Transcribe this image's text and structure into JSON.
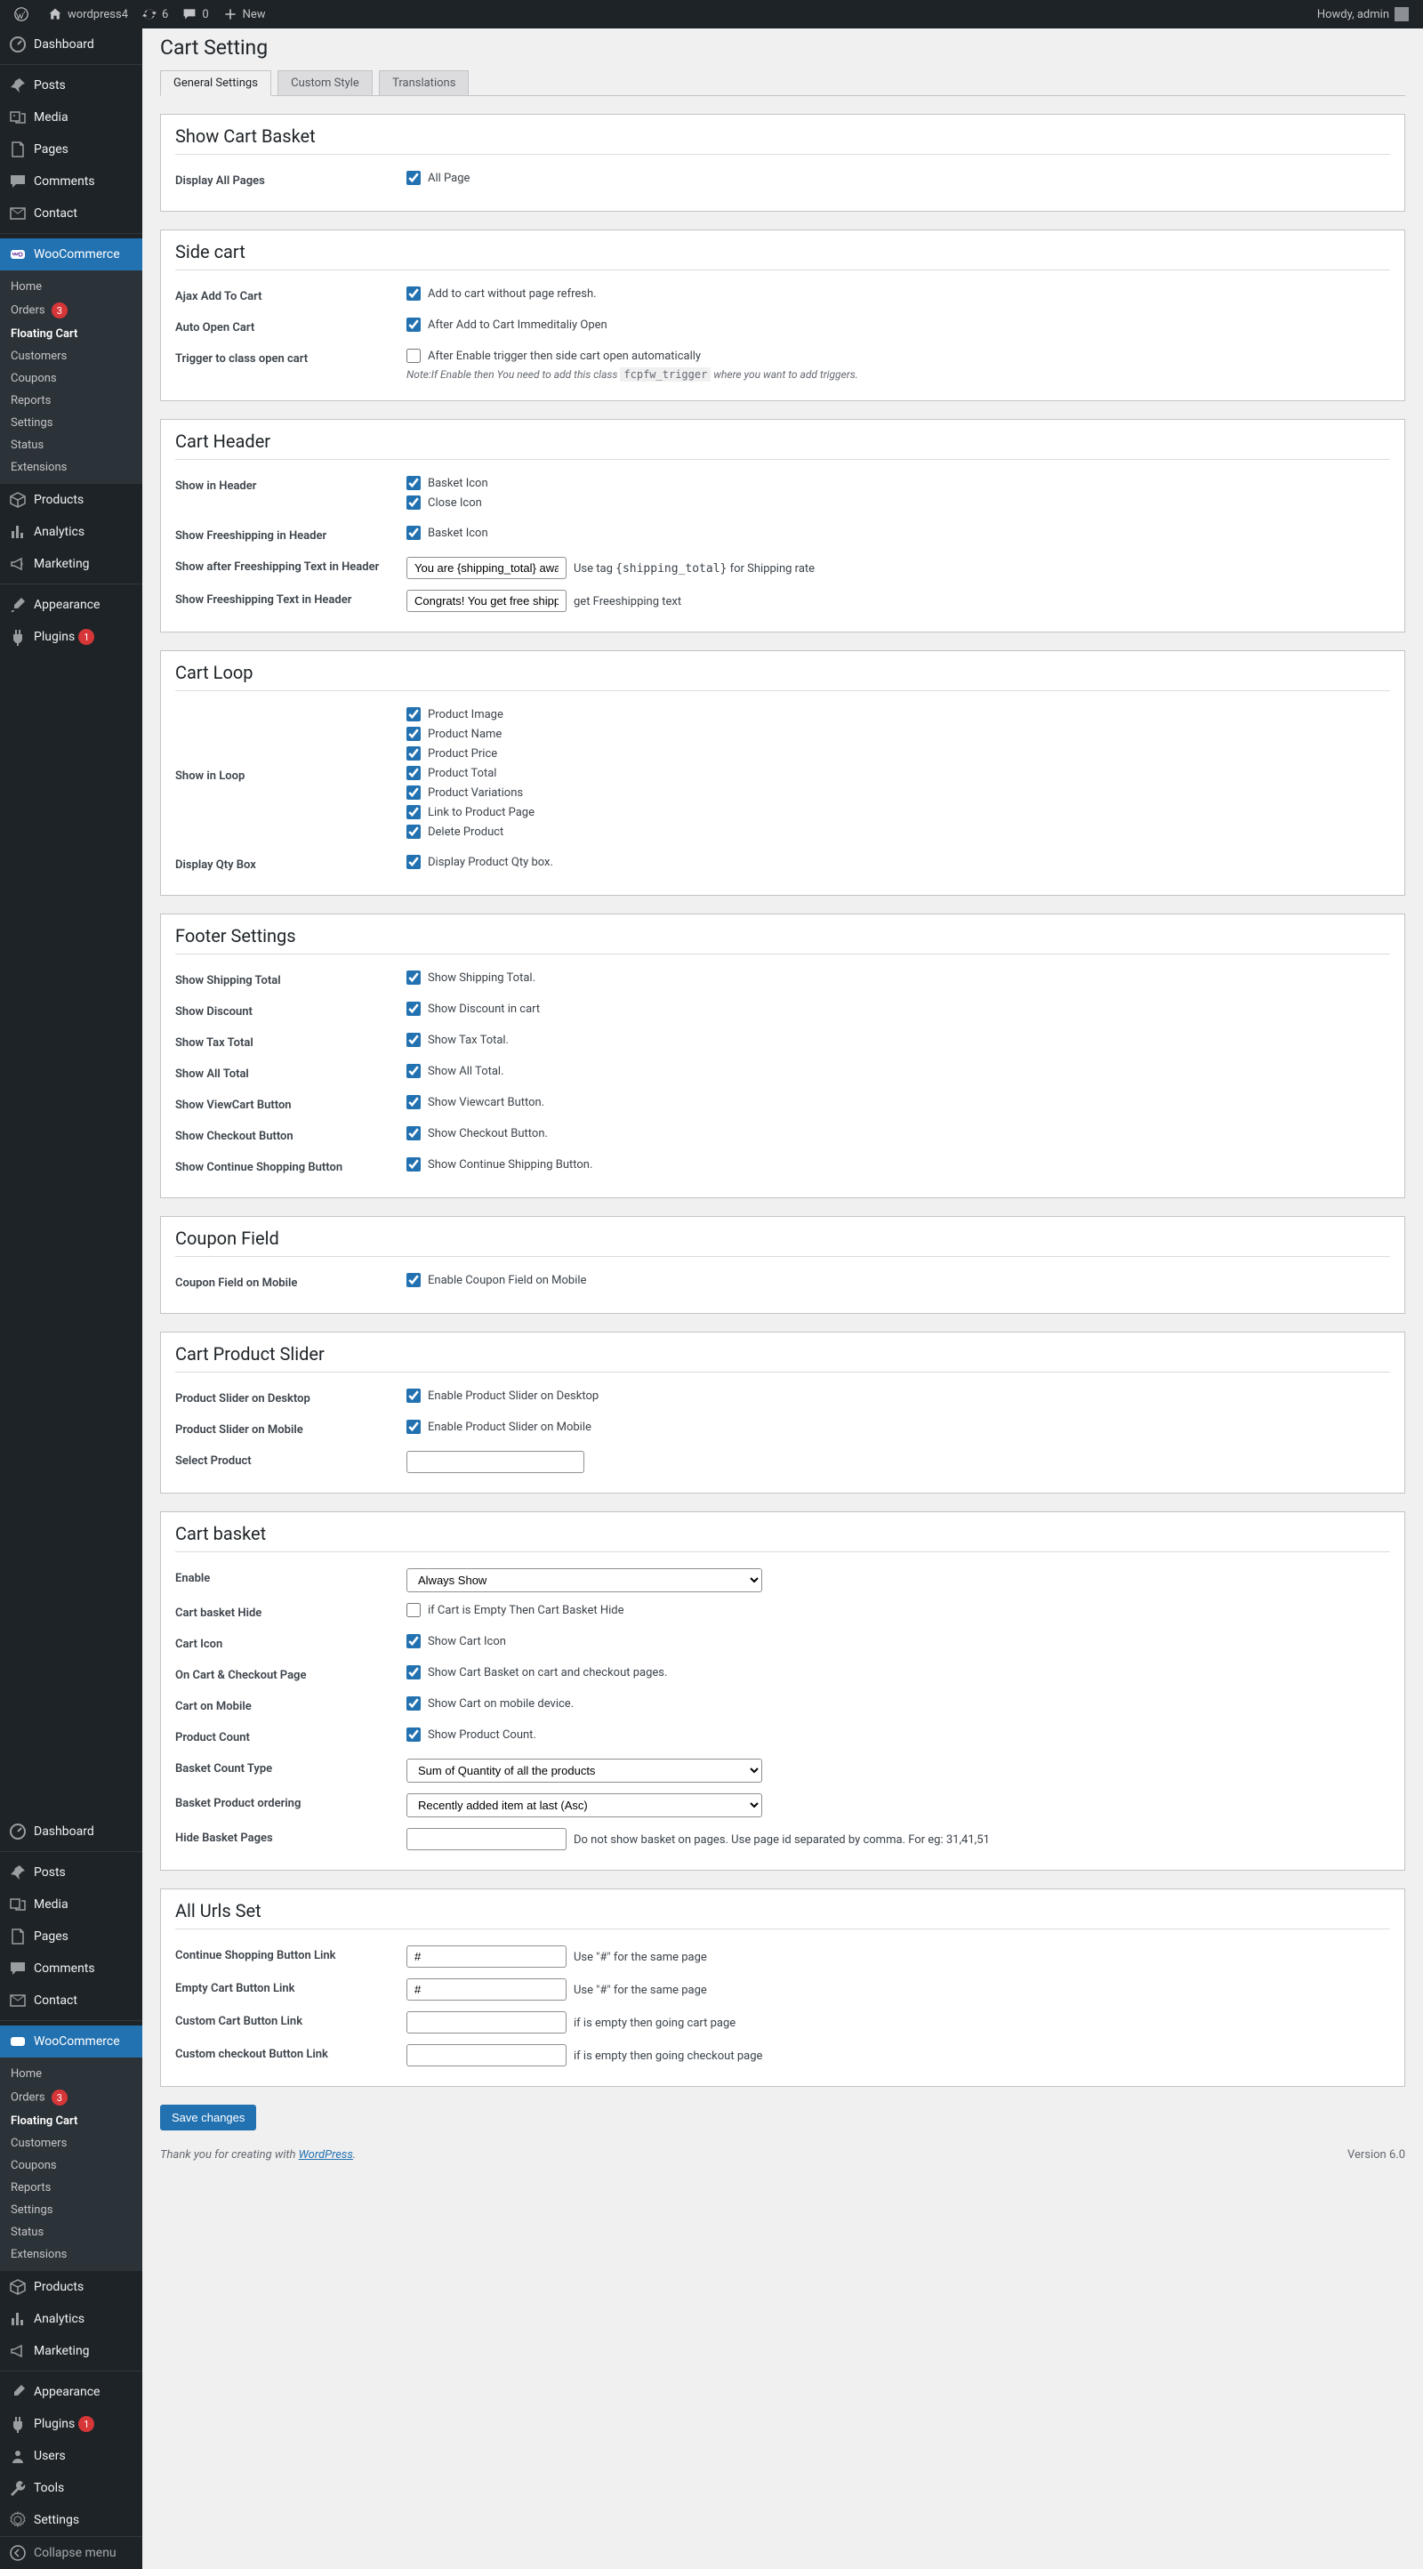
{
  "adminbar": {
    "site_name": "wordpress4",
    "updates": "6",
    "comments": "0",
    "new": "New",
    "howdy": "Howdy, admin"
  },
  "sidebar": {
    "dashboard": "Dashboard",
    "posts": "Posts",
    "media": "Media",
    "pages": "Pages",
    "comments": "Comments",
    "contact": "Contact",
    "woocommerce": "WooCommerce",
    "woo_sub": {
      "home": "Home",
      "orders": "Orders",
      "orders_badge": "3",
      "floating_cart": "Floating Cart",
      "customers": "Customers",
      "coupons": "Coupons",
      "reports": "Reports",
      "settings": "Settings",
      "status": "Status",
      "extensions": "Extensions"
    },
    "products": "Products",
    "analytics": "Analytics",
    "marketing": "Marketing",
    "appearance": "Appearance",
    "plugins": "Plugins",
    "plugins_badge": "1",
    "users": "Users",
    "tools": "Tools",
    "settings": "Settings",
    "collapse": "Collapse menu"
  },
  "page": {
    "title": "Cart Setting",
    "tabs": {
      "general": "General Settings",
      "custom": "Custom Style",
      "translations": "Translations"
    }
  },
  "show_cart_basket": {
    "heading": "Show Cart Basket",
    "display_all_pages": "Display All Pages",
    "all_page": "All Page"
  },
  "side_cart": {
    "heading": "Side cart",
    "ajax_add_label": "Ajax Add To Cart",
    "ajax_add_desc": "Add to cart without page refresh.",
    "auto_open_label": "Auto Open Cart",
    "auto_open_desc": "After Add to Cart Immeditaliy Open",
    "trigger_label": "Trigger to class open cart",
    "trigger_desc": "After Enable trigger then side cart open automatically",
    "trigger_note_pre": "Note:If Enable then You need to add this class",
    "trigger_note_code": "fcpfw_trigger",
    "trigger_note_post": "where you want to add triggers."
  },
  "cart_header": {
    "heading": "Cart Header",
    "show_in_header": "Show in Header",
    "basket_icon": "Basket Icon",
    "close_icon": "Close Icon",
    "freeshipping_header": "Show Freeshipping in Header",
    "after_freeshipping_label": "Show after Freeshipping Text in Header",
    "after_freeshipping_value": "You are {shipping_total} away",
    "after_note_pre": "Use tag",
    "after_note_code": "{shipping_total}",
    "after_note_post": "for Shipping rate",
    "freeshipping_text_label": "Show Freeshipping Text in Header",
    "freeshipping_text_value": "Congrats! You get free shipping",
    "freeshipping_text_note": "get Freeshipping text"
  },
  "cart_loop": {
    "heading": "Cart Loop",
    "show_in_loop": "Show in Loop",
    "items": [
      "Product Image",
      "Product Name",
      "Product Price",
      "Product Total",
      "Product Variations",
      "Link to Product Page",
      "Delete Product"
    ],
    "qty_label": "Display Qty Box",
    "qty_desc": "Display Product Qty box."
  },
  "footer_settings": {
    "heading": "Footer Settings",
    "rows": [
      {
        "label": "Show Shipping Total",
        "desc": "Show Shipping Total."
      },
      {
        "label": "Show Discount",
        "desc": "Show Discount in cart"
      },
      {
        "label": "Show Tax Total",
        "desc": "Show Tax Total."
      },
      {
        "label": "Show All Total",
        "desc": "Show All Total."
      },
      {
        "label": "Show ViewCart Button",
        "desc": "Show Viewcart Button."
      },
      {
        "label": "Show Checkout Button",
        "desc": "Show Checkout Button."
      },
      {
        "label": "Show Continue Shopping Button",
        "desc": "Show Continue Shipping Button."
      }
    ]
  },
  "coupon": {
    "heading": "Coupon Field",
    "label": "Coupon Field on Mobile",
    "desc": "Enable Coupon Field on Mobile"
  },
  "slider": {
    "heading": "Cart Product Slider",
    "desktop_label": "Product Slider on Desktop",
    "desktop_desc": "Enable Product Slider on Desktop",
    "mobile_label": "Product Slider on Mobile",
    "mobile_desc": "Enable Product Slider on Mobile",
    "select_label": "Select Product"
  },
  "basket": {
    "heading": "Cart basket",
    "enable": "Enable",
    "enable_options": [
      "Always Show"
    ],
    "hide_label": "Cart basket Hide",
    "hide_desc": "if Cart is Empty Then Cart Basket Hide",
    "icon_label": "Cart Icon",
    "icon_desc": "Show Cart Icon",
    "checkout_label": "On Cart & Checkout Page",
    "checkout_desc": "Show Cart Basket on cart and checkout pages.",
    "mobile_label": "Cart on Mobile",
    "mobile_desc": "Show Cart on mobile device.",
    "count_label": "Product Count",
    "count_desc": "Show Product Count.",
    "count_type_label": "Basket Count Type",
    "count_type_options": [
      "Sum of Quantity of all the products"
    ],
    "ordering_label": "Basket Product ordering",
    "ordering_options": [
      "Recently added item at last (Asc)"
    ],
    "hide_pages_label": "Hide Basket Pages",
    "hide_pages_note": "Do not show basket on pages. Use page id separated by comma. For eg: 31,41,51"
  },
  "urls": {
    "heading": "All Urls Set",
    "continue_label": "Continue Shopping Button Link",
    "continue_value": "#",
    "continue_note": "Use \"#\" for the same page",
    "empty_label": "Empty Cart Button Link",
    "empty_value": "#",
    "empty_note": "Use \"#\" for the same page",
    "custom_cart_label": "Custom Cart Button Link",
    "custom_cart_note": "if is empty then going cart page",
    "custom_checkout_label": "Custom checkout Button Link",
    "custom_checkout_note": "if is empty then going checkout page"
  },
  "save_button": "Save changes",
  "footer": {
    "thanks_pre": "Thank you for creating with ",
    "thanks_link": "WordPress",
    "thanks_post": ".",
    "version": "Version 6.0"
  }
}
